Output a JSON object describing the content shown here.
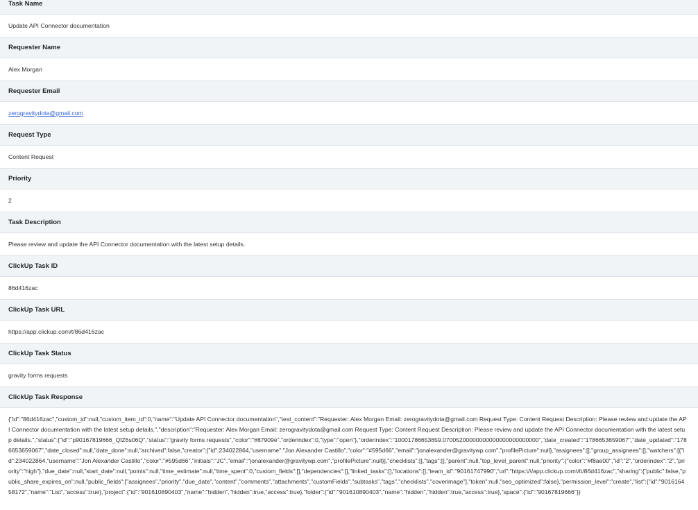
{
  "fields": [
    {
      "label": "Task Name",
      "value": "Update API Connector documentation"
    },
    {
      "label": "Requester Name",
      "value": "Alex Morgan"
    },
    {
      "label": "Requester Email",
      "value": "zerogravitydota@gmail.com"
    },
    {
      "label": "Request Type",
      "value": "Content Request"
    },
    {
      "label": "Priority",
      "value": "2"
    },
    {
      "label": "Task Description",
      "value": "Please review and update the API Connector documentation with the latest setup details."
    },
    {
      "label": "ClickUp Task ID",
      "value": "86d416zac"
    },
    {
      "label": "ClickUp Task URL",
      "value": "https://app.clickup.com/t/86d416zac"
    },
    {
      "label": "ClickUp Task Status",
      "value": "gravity forms requests"
    },
    {
      "label": "ClickUp Task Response",
      "value": "{\"id\":\"86d416zac\",\"custom_id\":null,\"custom_item_id\":0,\"name\":\"Update API Connector documentation\",\"text_content\":\"Requester: Alex Morgan Email: zerogravitydota@gmail.com Request Type: Content Request Description: Please review and update the API Connector documentation with the latest setup details.\",\"description\":\"Requester: Alex Morgan Email: zerogravitydota@gmail.com Request Type: Content Request Description: Please review and update the API Connector documentation with the latest setup details.\",\"status\":{\"id\":\"p90167819666_QfZ6s06Q\",\"status\":\"gravity forms requests\",\"color\":\"#87909e\",\"orderindex\":0,\"type\":\"open\"},\"orderindex\":\"10001786653659.07005200000000000000000000000\",\"date_created\":\"1786653659067\",\"date_updated\":\"1786653659067\",\"date_closed\":null,\"date_done\":null,\"archived\":false,\"creator\":{\"id\":234022864,\"username\":\"Jon Alexander Castillo\",\"color\":\"#595d66\",\"email\":\"jonalexander@gravitywp.com\",\"profilePicture\":null},\"assignees\":[],\"group_assignees\":[],\"watchers\":[{\"id\":234022864,\"username\":\"Jon Alexander Castillo\",\"color\":\"#595d66\",\"initials\":\"JC\",\"email\":\"jonalexander@gravitywp.com\",\"profilePicture\":null}],\"checklists\":[],\"tags\":[],\"parent\":null,\"top_level_parent\":null,\"priority\":{\"color\":\"#f8ae00\",\"id\":\"2\",\"orderindex\":\"2\",\"priority\":\"high\"},\"due_date\":null,\"start_date\":null,\"points\":null,\"time_estimate\":null,\"time_spent\":0,\"custom_fields\":[],\"dependencies\":[],\"linked_tasks\":[],\"locations\":[],\"team_id\":\"90161747990\",\"url\":\"https:\\/\\/app.clickup.com\\/t\\/86d416zac\",\"sharing\":{\"public\":false,\"public_share_expires_on\":null,\"public_fields\":[\"assignees\",\"priority\",\"due_date\",\"content\",\"comments\",\"attachments\",\"customFields\",\"subtasks\",\"tags\",\"checklists\",\"coverimage\"],\"token\":null,\"seo_optimized\":false},\"permission_level\":\"create\",\"list\":{\"id\":\"901616458172\",\"name\":\"List\",\"access\":true},\"project\":{\"id\":\"901610890403\",\"name\":\"hidden\",\"hidden\":true,\"access\":true},\"folder\":{\"id\":\"901610890403\",\"name\":\"hidden\",\"hidden\":true,\"access\":true},\"space\":{\"id\":\"90167819666\"}}"
    }
  ]
}
